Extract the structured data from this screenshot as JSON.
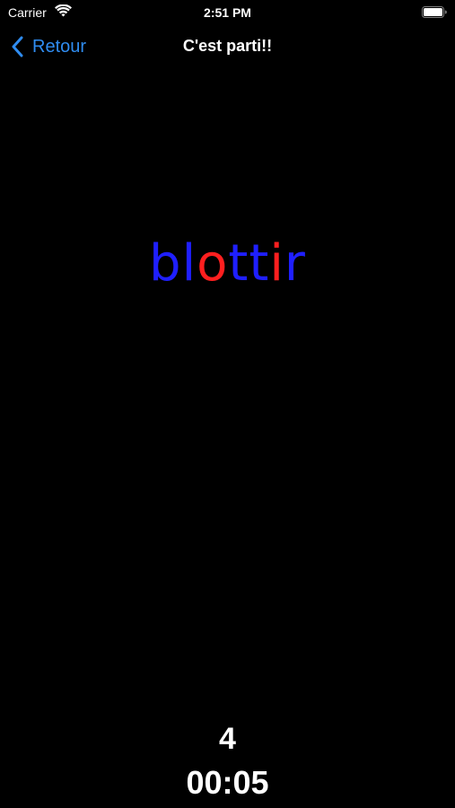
{
  "status_bar": {
    "carrier": "Carrier",
    "time": "2:51 PM",
    "icons": [
      "wifi-icon",
      "battery-icon"
    ]
  },
  "nav": {
    "back_label": "Retour",
    "title": "C'est parti!!"
  },
  "word": {
    "letters": [
      {
        "char": "b",
        "color": "#1f1fff"
      },
      {
        "char": "l",
        "color": "#1f1fff"
      },
      {
        "char": "o",
        "color": "#ff1f1f"
      },
      {
        "char": "t",
        "color": "#1f1fff"
      },
      {
        "char": "t",
        "color": "#1f1fff"
      },
      {
        "char": "i",
        "color": "#ff1f1f"
      },
      {
        "char": "r",
        "color": "#1f1fff"
      }
    ]
  },
  "counter": {
    "count": "4",
    "timer": "00:05"
  },
  "colors": {
    "background": "#000000",
    "accent": "#2f8cf0",
    "vowel": "#ff1f1f",
    "consonant": "#1f1fff"
  }
}
